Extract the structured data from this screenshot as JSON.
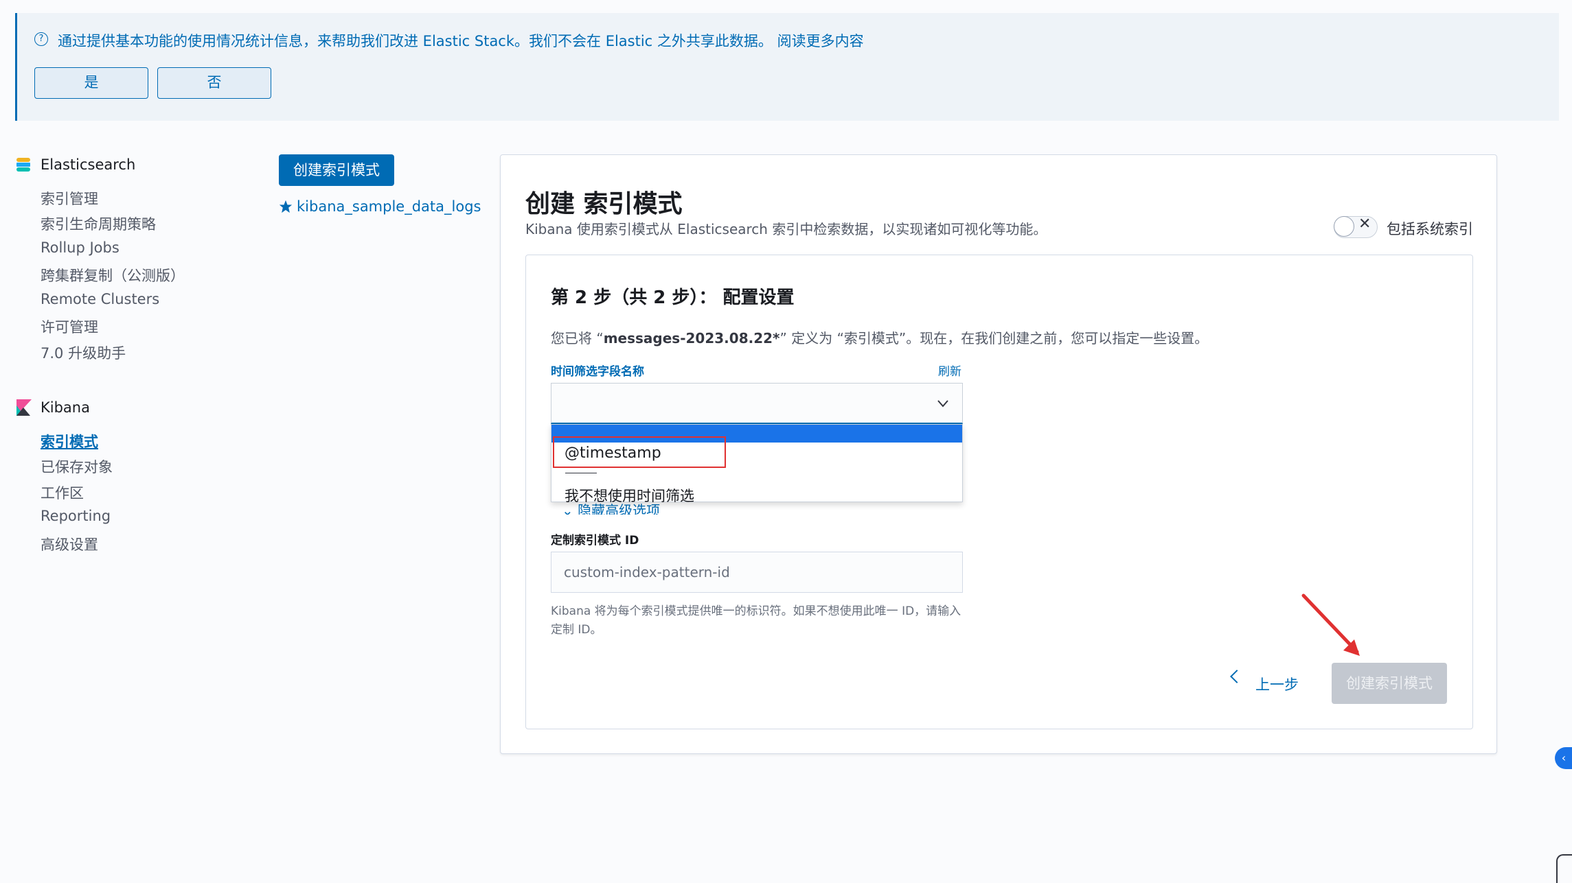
{
  "banner": {
    "icon": "question-circle-icon",
    "text": "通过提供基本功能的使用情况统计信息，来帮助我们改进 Elastic Stack。我们不会在 Elastic 之外共享此数据。 阅读更多内容",
    "yes_label": "是",
    "no_label": "否"
  },
  "sidebar": {
    "elasticsearch": {
      "header": "Elasticsearch",
      "items": [
        "索引管理",
        "索引生命周期策略",
        "Rollup Jobs",
        "跨集群复制（公测版）",
        "Remote Clusters",
        "许可管理",
        "7.0 升级助手"
      ]
    },
    "kibana": {
      "header": "Kibana",
      "items": [
        "索引模式",
        "已保存对象",
        "工作区",
        "Reporting",
        "高级设置"
      ],
      "active": "索引模式"
    }
  },
  "patterns": {
    "create_button": "创建索引模式",
    "default_pattern": "kibana_sample_data_logs"
  },
  "main": {
    "title": "创建 索引模式",
    "description": "Kibana 使用索引模式从 Elasticsearch 索引中检索数据，以实现诸如可视化等功能。",
    "include_system_label": "包括系统索引",
    "include_system_checked": false,
    "step": {
      "title": "第 2 步（共 2 步）：  配置设置",
      "desc_prefix": "您已将 “",
      "desc_pattern": "messages-2023.08.22*",
      "desc_suffix": "” 定义为 “索引模式”。现在，在我们创建之前，您可以指定一些设置。",
      "time_field_label": "时间筛选字段名称",
      "refresh_label": "刷新",
      "time_field_value": "",
      "options": [
        "@timestamp",
        "我不想使用时间筛选"
      ],
      "advanced_toggle": "隐藏高级选项",
      "custom_id_label": "定制索引模式 ID",
      "custom_id_placeholder": "custom-index-pattern-id",
      "custom_id_help": "Kibana 将为每个索引模式提供唯一的标识符。如果不想使用此唯一 ID，请输入定制 ID。",
      "back_label": "上一步",
      "create_label": "创建索引模式"
    }
  },
  "colors": {
    "primary": "#006bb4",
    "highlight_box": "#e03131",
    "annotation_arrow": "#e03131",
    "disabled_button": "#c3c8d0"
  }
}
